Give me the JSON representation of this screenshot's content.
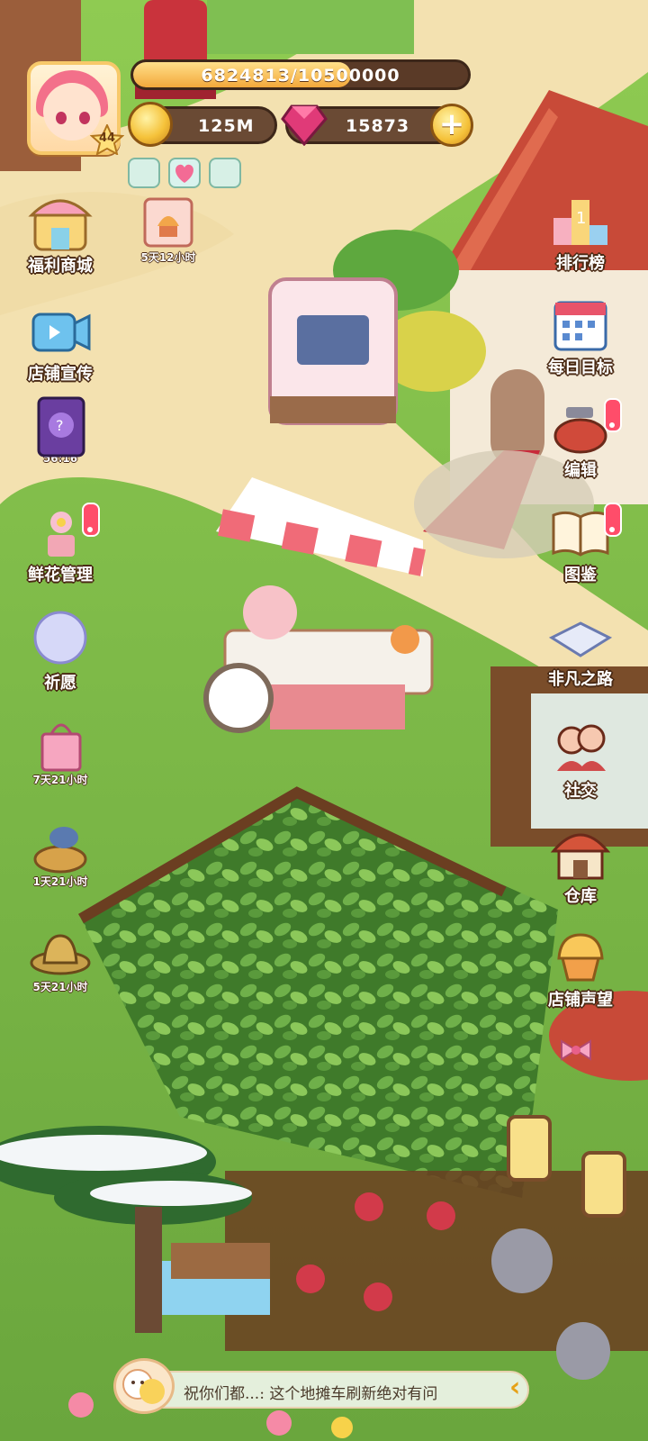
{
  "player": {
    "level": "44",
    "xp_text": "6824813/10500000",
    "xp_fraction": 0.65
  },
  "currency": {
    "coins": "125M",
    "gems": "15873"
  },
  "left_menu": {
    "shop": {
      "label": "福利商城"
    },
    "timed_1": {
      "timer": "5天12小时"
    },
    "promo": {
      "label": "店铺宣传"
    },
    "book": {
      "timer": "56:16"
    },
    "flowers": {
      "label": "鲜花管理"
    },
    "wish": {
      "label": "祈愿"
    },
    "gift": {
      "timer": "7天21小时"
    },
    "bird": {
      "timer": "1天21小时"
    },
    "hat": {
      "timer": "5天21小时"
    }
  },
  "right_menu": {
    "ranking": {
      "label": "排行榜"
    },
    "daily": {
      "label": "每日目标"
    },
    "edit": {
      "label": "编辑"
    },
    "atlas": {
      "label": "图鉴"
    },
    "road": {
      "label": "非凡之路"
    },
    "social": {
      "label": "社交"
    },
    "warehouse": {
      "label": "仓库"
    },
    "reputation": {
      "label": "店铺声望"
    }
  },
  "chat": {
    "message": "祝你们都...: 这个地摊车刷新绝对有问"
  },
  "colors": {
    "grass": "#7cb84a",
    "path": "#f2dfae",
    "awning_red": "#f06b78",
    "roof_red": "#c84a38",
    "label_outline": "#4a2a14"
  }
}
